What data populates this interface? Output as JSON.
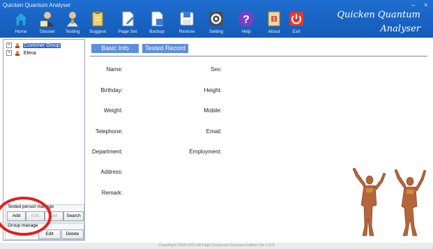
{
  "window": {
    "title": "Quicken Quantum Analyser",
    "minimize": "–",
    "close": "×"
  },
  "toolbar": [
    {
      "label": "Home",
      "icon": "home-icon"
    },
    {
      "label": "Dossier",
      "icon": "dossier-icon"
    },
    {
      "label": "Testing",
      "icon": "testing-icon"
    },
    {
      "label": "Suggest",
      "icon": "suggest-icon"
    },
    {
      "label": "Page Set",
      "icon": "page-set-icon"
    },
    {
      "label": "Backup",
      "icon": "backup-icon"
    },
    {
      "label": "Restore",
      "icon": "restore-icon"
    },
    {
      "label": "Setting",
      "icon": "setting-icon"
    },
    {
      "label": "Help",
      "icon": "help-icon"
    },
    {
      "label": "About",
      "icon": "about-icon"
    },
    {
      "label": "Exit",
      "icon": "exit-icon"
    }
  ],
  "brand": {
    "line1": "Quicken Quantum",
    "line2": "Analyser"
  },
  "tree": [
    {
      "label": "Customer Group",
      "selected": true
    },
    {
      "label": "Elena",
      "selected": false
    }
  ],
  "tested_person": {
    "title": "Tested person manage",
    "add": "Add",
    "edit": "Edit",
    "del": "Del",
    "search": "Search"
  },
  "group_manage": {
    "title": "Group manage",
    "edit": "Edit",
    "delete": "Delete"
  },
  "tabs": {
    "basic": "Basic Info",
    "record": "Tested Record"
  },
  "fields": {
    "name": "Name:",
    "sex": "Sex:",
    "birthday": "Birthday:",
    "height": "Height:",
    "weight": "Weight:",
    "mobile": "Mobile:",
    "telephone": "Telephone:",
    "email": "Email:",
    "department": "Department:",
    "employment": "Employment:",
    "address": "Address:",
    "remark": "Remark:"
  },
  "footer": "CopyRight 2009-2015  All Right Reserved   Standard Edition Ver 2.9.9",
  "colors": {
    "header": "#1e6ed0",
    "tab": "#5b8fdc",
    "highlight": "#e31e1e"
  }
}
